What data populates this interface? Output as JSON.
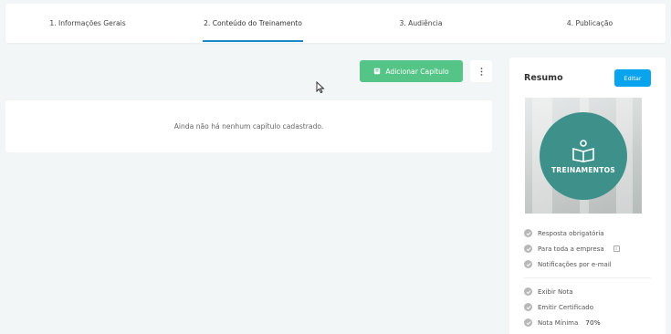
{
  "stepper": {
    "steps": [
      {
        "label": "1. Informações Gerais"
      },
      {
        "label": "2. Conteúdo do Treinamento"
      },
      {
        "label": "3. Audiência"
      },
      {
        "label": "4. Publicação"
      }
    ],
    "active_index": 1
  },
  "toolbar": {
    "add_chapter_label": "Adicionar Capítulo",
    "more_icon": "vertical-dots-icon"
  },
  "content": {
    "empty_message": "Ainda não há nenhum capítulo cadastrado."
  },
  "summary": {
    "title": "Resumo",
    "edit_label": "Editar",
    "thumbnail_badge": "TREINAMENTOS",
    "options_group1": [
      {
        "label": "Resposta obrigatória"
      },
      {
        "label": "Para toda a empresa"
      },
      {
        "label": "Notificações por e-mail"
      }
    ],
    "options_group2": [
      {
        "label": "Exibir Nota"
      },
      {
        "label": "Emitir Certificado"
      },
      {
        "label": "Nota Mínima"
      }
    ],
    "min_grade_value": "70%"
  },
  "colors": {
    "accent_blue": "#1e88c7",
    "add_button_green": "#55c487",
    "edit_button_blue": "#0aa3ee",
    "badge_teal": "#3d918a",
    "background": "#f3f6f7"
  }
}
